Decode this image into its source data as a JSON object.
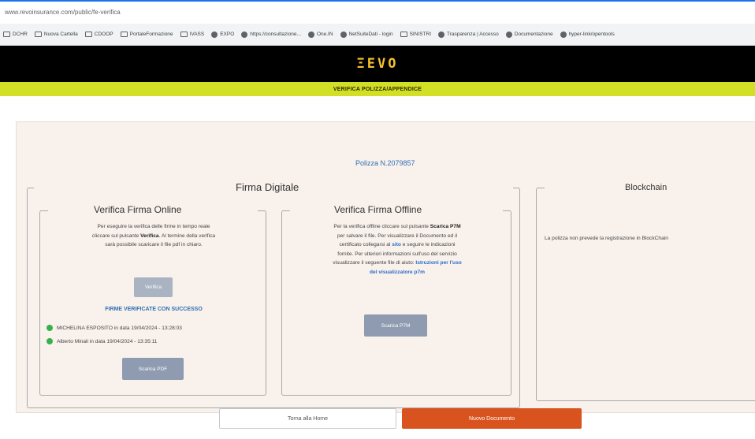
{
  "browser": {
    "url": "www.revoinsurance.com/public/fe-verifica",
    "bookmarks": [
      {
        "label": "DCHR",
        "icon": "folder-icon"
      },
      {
        "label": "Nuova Cartella",
        "icon": "folder-icon"
      },
      {
        "label": "CDOOP",
        "icon": "folder-icon"
      },
      {
        "label": "PortaleFormazione",
        "icon": "folder-icon"
      },
      {
        "label": "IVASS",
        "icon": "folder-icon"
      },
      {
        "label": "EXPO",
        "icon": "globe-icon"
      },
      {
        "label": "https://consultazione...",
        "icon": "globe-icon"
      },
      {
        "label": "One.IN",
        "icon": "globe-icon"
      },
      {
        "label": "NetSuiteDati - login",
        "icon": "globe-icon"
      },
      {
        "label": "SINISTRI",
        "icon": "folder-icon"
      },
      {
        "label": "Trasparenza | Accesso",
        "icon": "globe-icon"
      },
      {
        "label": "Documentazione",
        "icon": "globe-icon"
      },
      {
        "label": "hyper-link/opentools",
        "icon": "github-icon"
      }
    ]
  },
  "header": {
    "logo": "ΞEVO",
    "subtitle": "VERIFICA POLIZZA/APPENDICE"
  },
  "main": {
    "policy_number": "Polizza N.2079857",
    "firma_digitale": {
      "title": "Firma Digitale",
      "online": {
        "title": "Verifica Firma Online",
        "text_line1": "Per eseguire la verifica delle firme in tempo reale",
        "text_line2a": "cliccare sul pulsante ",
        "text_line2b": "Verifica",
        "text_line2c": ". Al termine della verifica",
        "text_line3": "sarà possibile scaricare il file pdf in chiaro.",
        "verify_button": "Verifica",
        "success_text": "FIRME VERIFICATE CON SUCCESSO",
        "signatures": [
          "MICHELINA ESPOSITO in data 19/04/2024 - 13:28:03",
          "Alberto Minali in data 19/04/2024 - 13:35:11"
        ],
        "download_pdf": "Scarica PDF"
      },
      "offline": {
        "title": "Verifica Firma Offline",
        "l1a": "Per la verifica offline cliccare sul pulsante ",
        "l1b": "Scarica P7M",
        "l2": "per salvare il file. Per visualizzare il Documento ed il",
        "l3a": "certificato collegarsi al ",
        "l3b": "sito",
        "l3c": " e seguire le indicazioni",
        "l4": "fornite. Per ulteriori informazioni sull'uso del servizio",
        "l5a": "visualizzare il seguente file di aiuto: ",
        "l5b": "Istruzioni per l'uso",
        "l6": "del visualizzatore p7m",
        "download_p7m": "Scarica P7M"
      }
    },
    "blockchain": {
      "title": "Blockchain",
      "text": "La polizza non prevede la registrazione in BlockChain"
    }
  },
  "footer": {
    "home_button": "Torna alla Home",
    "new_doc_button": "Nuovo Documento"
  },
  "colors": {
    "header_bg": "#000000",
    "accent_yellow": "#d2e025",
    "link_blue": "#2f6fb3",
    "orange": "#d9531e",
    "success_green": "#35b24a"
  }
}
